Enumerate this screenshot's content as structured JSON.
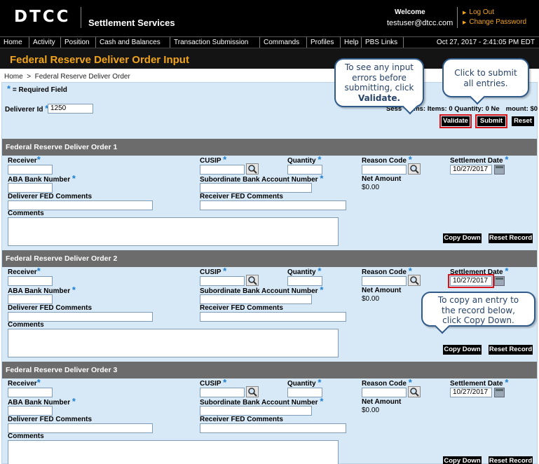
{
  "app": {
    "logo": "DTCC",
    "name": "Settlement Services",
    "welcome": "Welcome",
    "user": "testuser@dtcc.com",
    "logout": "Log Out",
    "change_password": "Change Password"
  },
  "nav": {
    "items": [
      "Home",
      "Activity",
      "Position",
      "Cash and Balances",
      "Transaction Submission",
      "Commands",
      "Profiles",
      "Help",
      "PBS Links"
    ],
    "datetime": "Oct 27, 2017 - 2:41:05 PM EDT"
  },
  "page": {
    "title": "Federal Reserve Deliver Order Input",
    "breadcrumb_home": "Home",
    "breadcrumb_sep": ">",
    "breadcrumb_current": "Federal Reserve Deliver Order",
    "required_note": "= Required Field",
    "deliverer_label": "Deliverer Id",
    "deliverer_value": "1250",
    "session_left": "Sess",
    "session_right": "ms: Items: 0 Quantity: 0 Ne",
    "session_tail": "mount: $0"
  },
  "buttons": {
    "validate": "Validate",
    "submit": "Submit",
    "reset": "Reset",
    "copy_down": "Copy Down",
    "reset_record": "Reset Record"
  },
  "labels": {
    "receiver": "Receiver",
    "cusip": "CUSIP",
    "quantity": "Quantity",
    "reason_code": "Reason Code",
    "settlement_date": "Settlement Date",
    "aba": "ABA Bank Number",
    "sub_account": "Subordinate Bank Account Number",
    "net_amount": "Net Amount",
    "deliverer_comments": "Deliverer FED Comments",
    "receiver_comments": "Receiver FED Comments",
    "comments": "Comments"
  },
  "orders": [
    {
      "title": "Federal Reserve Deliver Order 1",
      "settlement_date": "10/27/2017",
      "net_amount": "$0.00"
    },
    {
      "title": "Federal Reserve Deliver Order 2",
      "settlement_date": "10/27/2017",
      "net_amount": "$0.00"
    },
    {
      "title": "Federal Reserve Deliver Order 3",
      "settlement_date": "10/27/2017",
      "net_amount": "$0.00"
    }
  ],
  "callouts": {
    "validate": [
      "To see any input",
      "errors before",
      "submitting, click",
      "Validate."
    ],
    "submit": [
      "Click to submit",
      "all entries."
    ],
    "copy": [
      "To copy an entry to",
      "the record below,",
      "click Copy Down."
    ]
  },
  "colors": {
    "accent": "#f2a51a",
    "panel": "#d7e9f7",
    "section": "#6c6c6c",
    "highlight": "#d9141b",
    "callout_border": "#2f5a8a"
  }
}
